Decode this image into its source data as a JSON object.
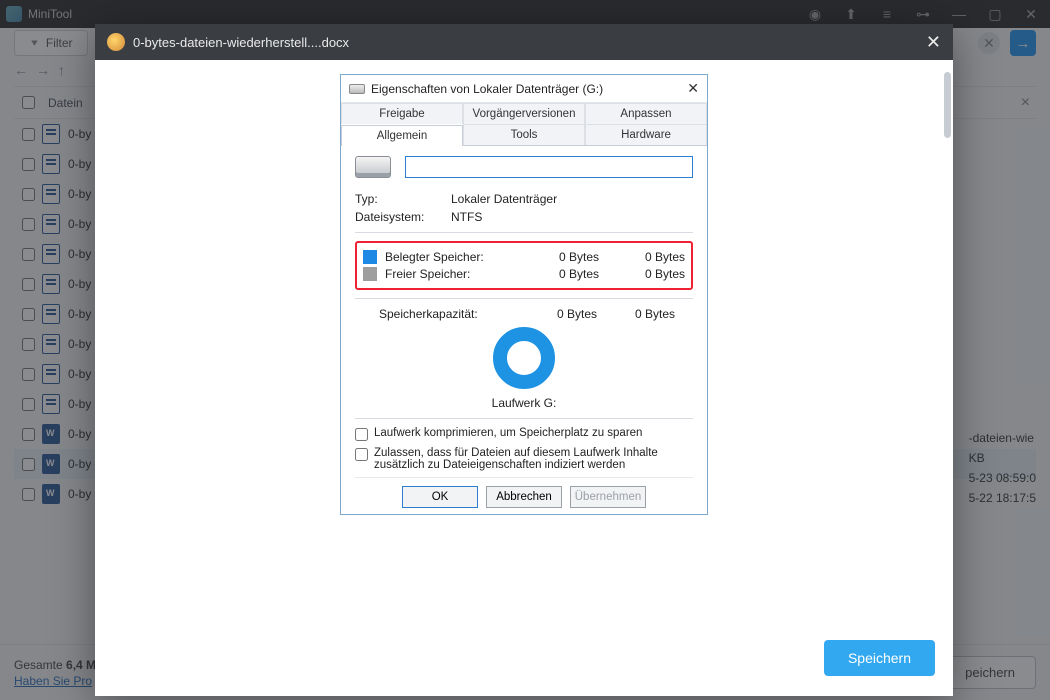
{
  "titlebar": {
    "title": "MiniTool"
  },
  "toolbar": {
    "filter": "Filter"
  },
  "list": {
    "header": "Datein",
    "rows": [
      {
        "name": "0-by",
        "type": "doc"
      },
      {
        "name": "0-by",
        "type": "doc"
      },
      {
        "name": "0-by",
        "type": "doc"
      },
      {
        "name": "0-by",
        "type": "doc"
      },
      {
        "name": "0-by",
        "type": "doc"
      },
      {
        "name": "0-by",
        "type": "doc"
      },
      {
        "name": "0-by",
        "type": "doc"
      },
      {
        "name": "0-by",
        "type": "doc"
      },
      {
        "name": "0-by",
        "type": "doc"
      },
      {
        "name": "0-by",
        "type": "doc"
      },
      {
        "name": "0-by",
        "type": "word"
      },
      {
        "name": "0-by",
        "type": "word",
        "selected": true
      },
      {
        "name": "0-by",
        "type": "word"
      }
    ]
  },
  "info": {
    "line1": "-dateien-wie",
    "line2": "KB",
    "line3": "5-23 08:59:0",
    "line4": "5-22 18:17:5"
  },
  "footer": {
    "total_label": "Gesamte",
    "total_value": "6,4 M",
    "link": "Haben Sie Pro",
    "save": "peichern"
  },
  "modal": {
    "title": "0-bytes-dateien-wiederherstell....docx",
    "primary": "Speichern"
  },
  "props": {
    "title": "Eigenschaften von Lokaler Datenträger (G:)",
    "tabs_top": [
      "Freigabe",
      "Vorgängerversionen",
      "Anpassen"
    ],
    "tabs_bot": [
      "Allgemein",
      "Tools",
      "Hardware"
    ],
    "type_k": "Typ:",
    "type_v": "Lokaler Datenträger",
    "fs_k": "Dateisystem:",
    "fs_v": "NTFS",
    "used_k": "Belegter Speicher:",
    "free_k": "Freier Speicher:",
    "zero": "0 Bytes",
    "zero2": "0 Bytes",
    "cap_k": "Speicherkapazität:",
    "drive_label": "Laufwerk G:",
    "opt1": "Laufwerk komprimieren, um Speicherplatz zu sparen",
    "opt2": "Zulassen, dass für Dateien auf diesem Laufwerk Inhalte zusätzlich zu Dateieigenschaften indiziert werden",
    "ok": "OK",
    "cancel": "Abbrechen",
    "apply": "Übernehmen"
  }
}
